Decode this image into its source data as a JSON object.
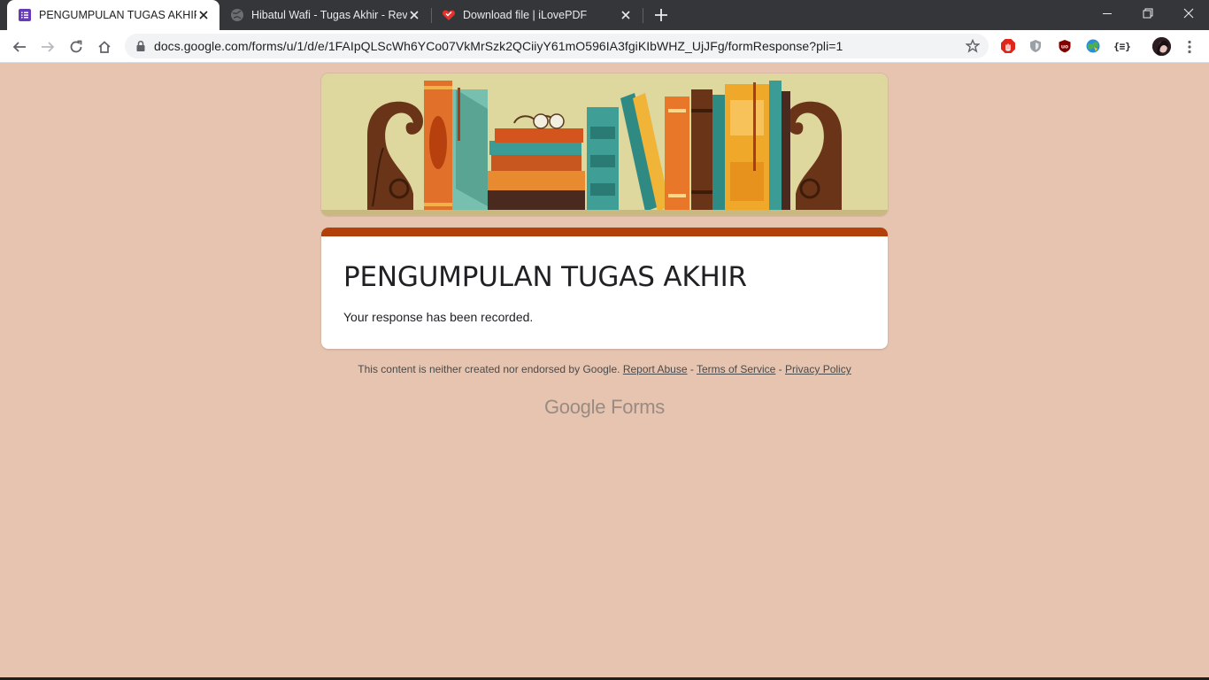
{
  "tabs": [
    {
      "title": "PENGUMPULAN TUGAS AKHIR",
      "active": true
    },
    {
      "title": "Hibatul Wafi - Tugas Akhir - RevC",
      "active": false
    },
    {
      "title": "Download file | iLovePDF",
      "active": false
    }
  ],
  "address_bar": {
    "url": "docs.google.com/forms/u/1/d/e/1FAIpQLScWh6YCo07VkMrSzk2QCiiyY61mO596IA3fgiKIbWHZ_UjJFg/formResponse?pli=1"
  },
  "form": {
    "title": "PENGUMPULAN TUGAS AKHIR",
    "message": "Your response has been recorded.",
    "accent_color": "#b2400b",
    "background_color": "#e6c4b0"
  },
  "footer": {
    "disclaimer": "This content is neither created nor endorsed by Google.",
    "report_abuse": "Report Abuse",
    "sep1": " - ",
    "terms": "Terms of Service",
    "sep2": " - ",
    "privacy": "Privacy Policy"
  },
  "branding": {
    "google": "Google",
    "forms": "Forms"
  }
}
